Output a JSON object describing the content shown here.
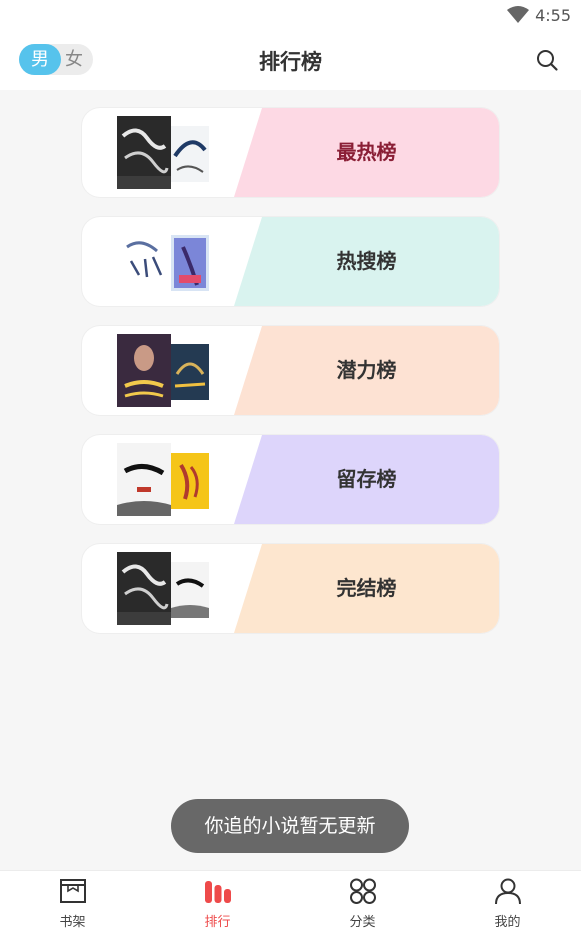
{
  "status_bar": {
    "time": "4:55",
    "wifi_icon": "wifi-icon"
  },
  "header": {
    "gender": {
      "male": "男",
      "female": "女",
      "selected": "male"
    },
    "title": "排行榜",
    "search_icon": "search-icon"
  },
  "ranks": [
    {
      "label": "最热榜",
      "tint": "#fdd9e4",
      "label_color": "#8a1f36"
    },
    {
      "label": "热搜榜",
      "tint": "#d9f3ef",
      "label_color": "#333333"
    },
    {
      "label": "潜力榜",
      "tint": "#fde2d3",
      "label_color": "#333333"
    },
    {
      "label": "留存榜",
      "tint": "#ddd5fb",
      "label_color": "#333333"
    },
    {
      "label": "完结榜",
      "tint": "#fde6cf",
      "label_color": "#333333"
    }
  ],
  "toast": "你追的小说暂无更新",
  "bottom_nav": [
    {
      "label": "书架",
      "icon": "bookshelf-icon",
      "active": false
    },
    {
      "label": "排行",
      "icon": "ranking-icon",
      "active": true
    },
    {
      "label": "分类",
      "icon": "category-icon",
      "active": false
    },
    {
      "label": "我的",
      "icon": "profile-icon",
      "active": false
    }
  ],
  "colors": {
    "accent": "#ee4a4a",
    "toggle_active": "#56c3ec"
  }
}
